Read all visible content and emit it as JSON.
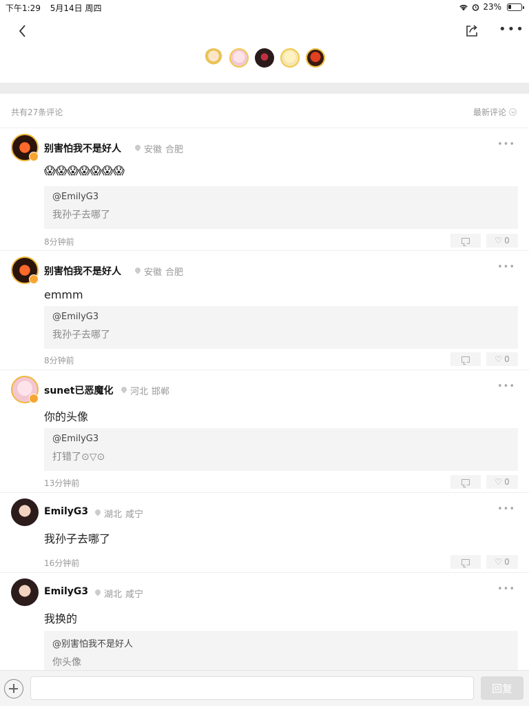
{
  "status": {
    "time": "下午1:29",
    "date": "5月14日 周四",
    "battery": "23%",
    "battery_level": 0.23
  },
  "header": {
    "share_icon": "share-icon",
    "more_icon": "more-icon"
  },
  "list": {
    "count_label": "共有27条评论",
    "sort_label": "最新评论"
  },
  "comments": [
    {
      "name": "别害怕我不是好人",
      "province": "安徽",
      "city": "合肥",
      "text": "😱😱😱😱😱😱😱",
      "quote_user": "@EmilyG3",
      "quote_text": "我孙子去哪了",
      "time": "8分钟前",
      "likes": "0"
    },
    {
      "name": "别害怕我不是好人",
      "province": "安徽",
      "city": "合肥",
      "text": "emmm",
      "quote_user": "@EmilyG3",
      "quote_text": "我孙子去哪了",
      "time": "8分钟前",
      "likes": "0"
    },
    {
      "name": "sunet已恶魔化",
      "province": "河北",
      "city": "邯郸",
      "text": "你的头像",
      "quote_user": "@EmilyG3",
      "quote_text": "打错了⊙▽⊙",
      "time": "13分钟前",
      "likes": "0"
    },
    {
      "name": "EmilyG3",
      "province": "湖北",
      "city": "咸宁",
      "text": "我孙子去哪了",
      "time": "16分钟前",
      "likes": "0"
    },
    {
      "name": "EmilyG3",
      "province": "湖北",
      "city": "咸宁",
      "text": "我换的",
      "quote_user": "@别害怕我不是好人",
      "quote_text": "你头像"
    }
  ],
  "composer": {
    "reply_label": "回复"
  },
  "colors": {
    "accent_gold": "#f0b73a",
    "badge_orange": "#f7a531",
    "divider": "#ececec"
  }
}
